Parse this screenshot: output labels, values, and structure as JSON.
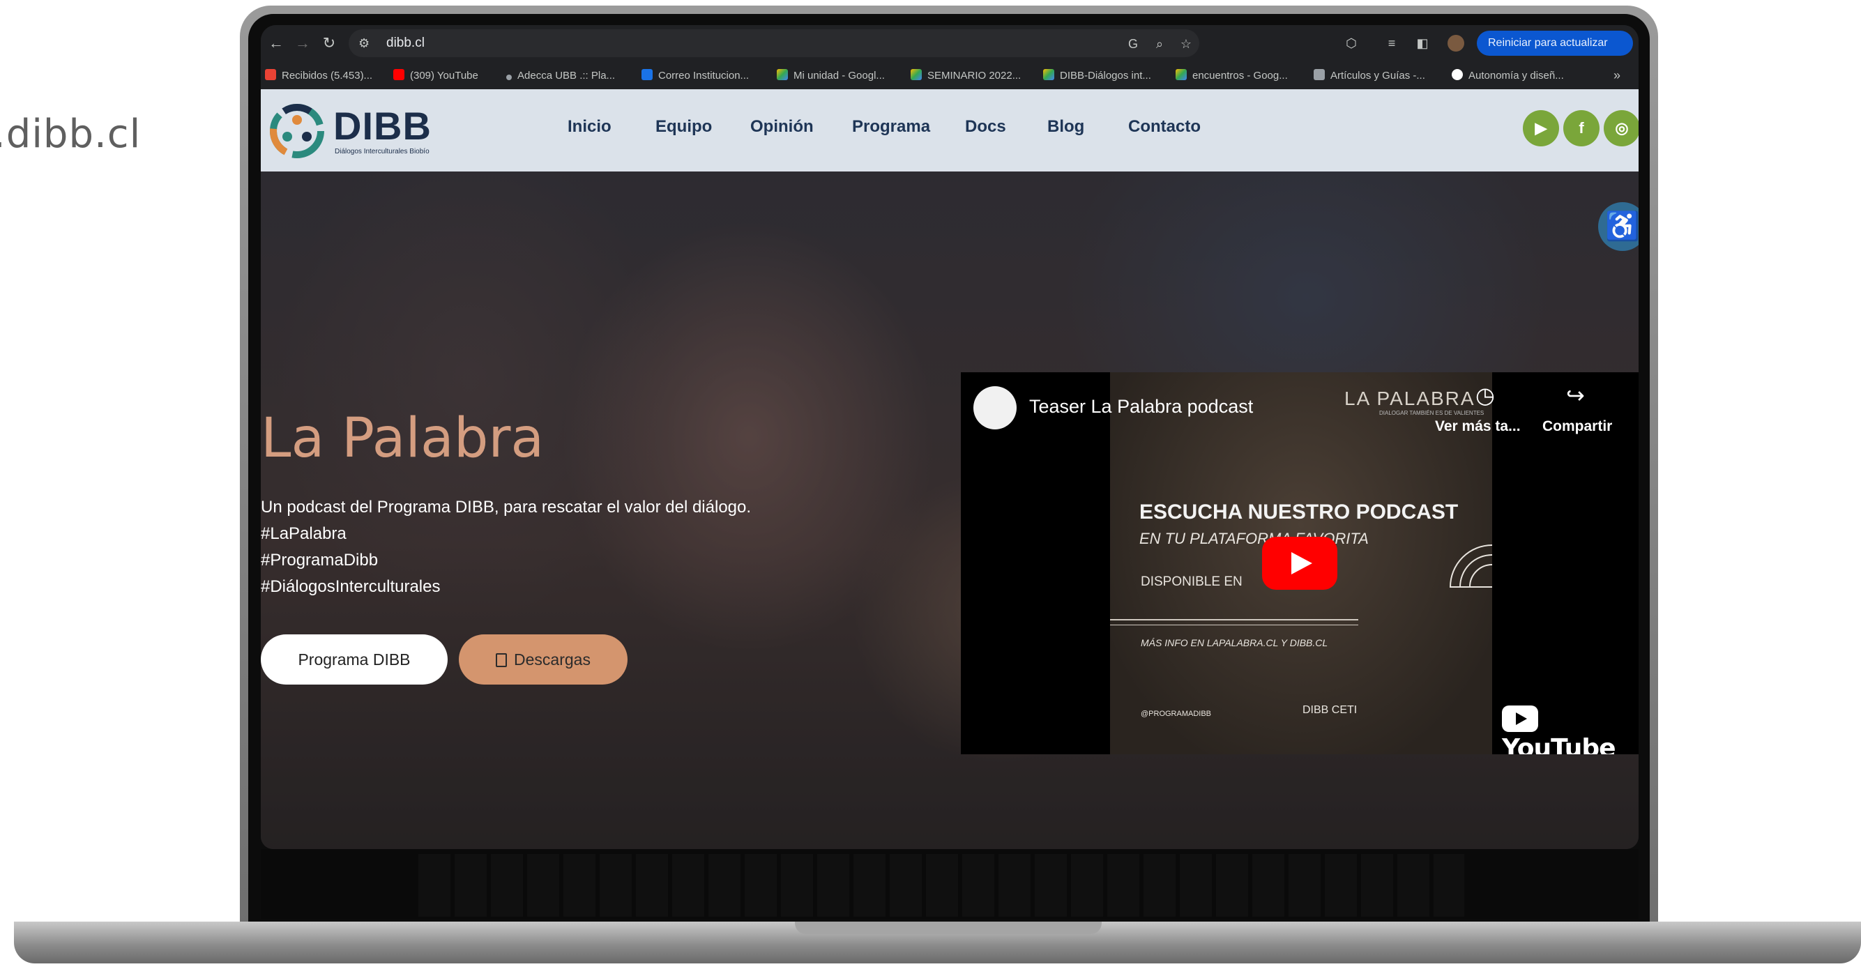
{
  "caption": ".dibb.cl",
  "browser": {
    "url": "dibb.cl",
    "update_button": "Reiniciar para actualizar",
    "bookmarks": [
      "Recibidos (5.453)...",
      "(309) YouTube",
      "Adecca UBB .:: Pla...",
      "Correo Institucion...",
      "Mi unidad - Googl...",
      "SEMINARIO 2022...",
      "DIBB-Diálogos int...",
      "encuentros - Goog...",
      "Artículos y Guías -...",
      "Autonomía y diseñ..."
    ],
    "bookmarks_more": "»"
  },
  "site": {
    "logo_text": "DIBB",
    "logo_subtitle": "Diálogos Interculturales Biobío",
    "menu": [
      "Inicio",
      "Equipo",
      "Opinión",
      "Programa",
      "Docs",
      "Blog",
      "Contacto"
    ],
    "social_icons": [
      "youtube-icon",
      "facebook-icon",
      "instagram-icon"
    ]
  },
  "hero": {
    "title": "La Palabra",
    "description": "Un podcast del Programa DIBB, para rescatar el valor del diálogo.",
    "hashtags": [
      "#LaPalabra",
      "#ProgramaDibb",
      "#DiálogosInterculturales"
    ],
    "button_primary": "Programa DIBB",
    "button_secondary": "Descargas"
  },
  "video": {
    "title": "Teaser La Palabra podcast",
    "brand": "LA PALABRA",
    "brand_sub": "DIALOGAR TAMBIÉN ES DE VALIENTES",
    "watch_later": "Ver más ta...",
    "share": "Compartir",
    "thumb_heading": "ESCUCHA NUESTRO PODCAST",
    "thumb_sub": "EN TU PLATAFORMA FAVORITA",
    "thumb_available": "DISPONIBLE EN",
    "thumb_more": "MÁS INFO EN LAPALABRA.CL Y DIBB.CL",
    "thumb_handle": "@PROGRAMADIBB",
    "thumb_logos": "DIBB   CETI",
    "yt_logo_text": "YouTube"
  },
  "colors": {
    "accent": "#d4956e",
    "title": "#d49d80",
    "nav_text": "#1e3556",
    "social_bg": "#7aa63a",
    "header_bg": "#dbe2ea"
  }
}
